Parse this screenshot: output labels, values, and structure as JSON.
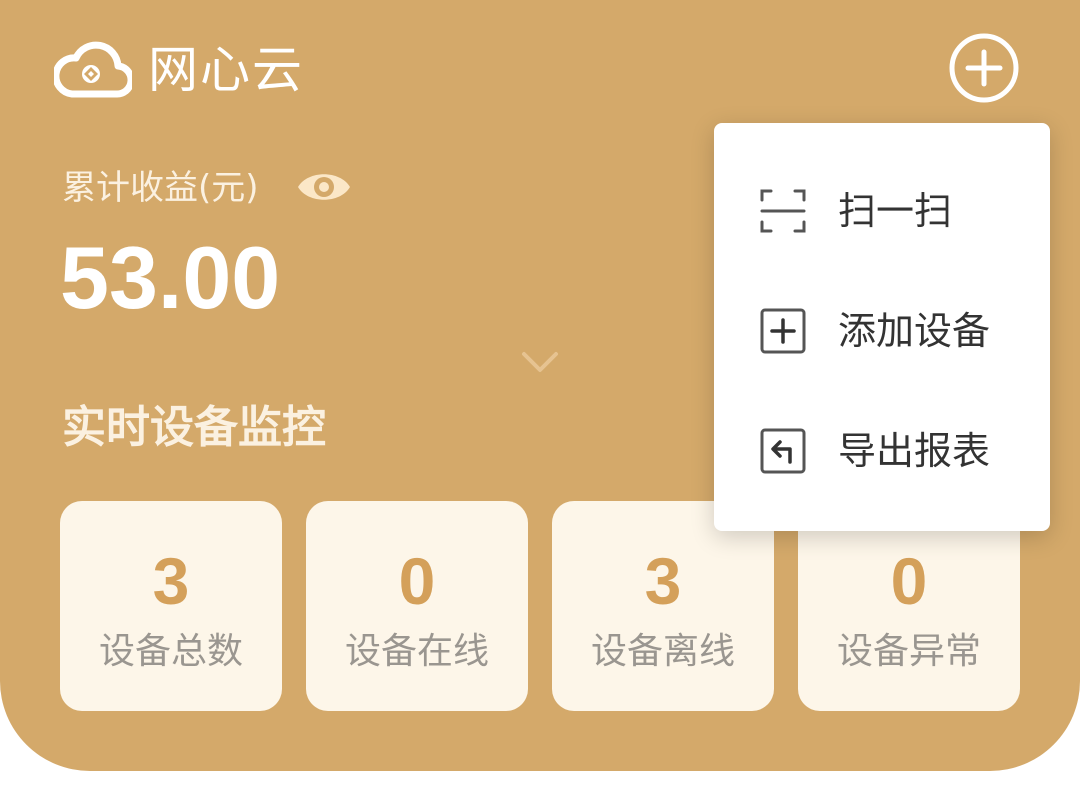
{
  "header": {
    "app_name": "网心云",
    "logo_icon": "cloud-logo-icon",
    "add_icon": "plus-circle-icon"
  },
  "earnings": {
    "label": "累计收益(元)",
    "value": "53.00",
    "visibility_icon": "eye-icon",
    "expand_icon": "chevron-down-icon"
  },
  "monitor": {
    "title": "实时设备监控",
    "stats": [
      {
        "value": "3",
        "label": "设备总数"
      },
      {
        "value": "0",
        "label": "设备在线"
      },
      {
        "value": "3",
        "label": "设备离线"
      },
      {
        "value": "0",
        "label": "设备异常"
      }
    ]
  },
  "menu": {
    "items": [
      {
        "label": "扫一扫",
        "icon": "scan-icon"
      },
      {
        "label": "添加设备",
        "icon": "add-square-icon"
      },
      {
        "label": "导出报表",
        "icon": "export-icon"
      }
    ]
  },
  "colors": {
    "card_bg": "#d4a96a",
    "tile_bg": "#fdf6e9",
    "stat_value": "#d4a05a",
    "stat_label": "#9a9690",
    "menu_text": "#333333"
  }
}
